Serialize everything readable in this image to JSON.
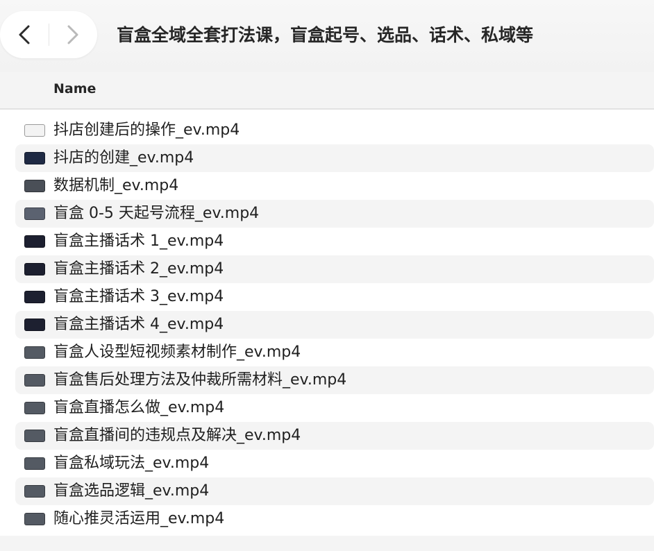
{
  "window": {
    "title": "盲盒全域全套打法课，盲盒起号、选品、话术、私域等",
    "back_icon": "chevron-left-icon",
    "forward_icon": "chevron-right-icon"
  },
  "columns": {
    "name": "Name"
  },
  "files": [
    {
      "name": "抖店创建后的操作_ev.mp4",
      "icon": "video-thumbnail-icon",
      "icon_color": "#f3f3f3"
    },
    {
      "name": "抖店的创建_ev.mp4",
      "icon": "video-thumbnail-icon",
      "icon_color": "#1f2a44"
    },
    {
      "name": "数据机制_ev.mp4",
      "icon": "video-thumbnail-icon",
      "icon_color": "#4a4f57"
    },
    {
      "name": "盲盒 0-5 天起号流程_ev.mp4",
      "icon": "video-thumbnail-icon",
      "icon_color": "#5b6270"
    },
    {
      "name": "盲盒主播话术 1_ev.mp4",
      "icon": "video-thumbnail-icon",
      "icon_color": "#1d2030"
    },
    {
      "name": "盲盒主播话术 2_ev.mp4",
      "icon": "video-thumbnail-icon",
      "icon_color": "#1d2030"
    },
    {
      "name": "盲盒主播话术 3_ev.mp4",
      "icon": "video-thumbnail-icon",
      "icon_color": "#1d2030"
    },
    {
      "name": "盲盒主播话术 4_ev.mp4",
      "icon": "video-thumbnail-icon",
      "icon_color": "#1d2030"
    },
    {
      "name": "盲盒人设型短视频素材制作_ev.mp4",
      "icon": "video-thumbnail-icon",
      "icon_color": "#545a63"
    },
    {
      "name": "盲盒售后处理方法及仲裁所需材料_ev.mp4",
      "icon": "video-thumbnail-icon",
      "icon_color": "#545a63"
    },
    {
      "name": "盲盒直播怎么做_ev.mp4",
      "icon": "video-thumbnail-icon",
      "icon_color": "#545a63"
    },
    {
      "name": "盲盒直播间的违规点及解决_ev.mp4",
      "icon": "video-thumbnail-icon",
      "icon_color": "#545a63"
    },
    {
      "name": "盲盒私域玩法_ev.mp4",
      "icon": "video-thumbnail-icon",
      "icon_color": "#545a63"
    },
    {
      "name": "盲盒选品逻辑_ev.mp4",
      "icon": "video-thumbnail-icon",
      "icon_color": "#545a63"
    },
    {
      "name": "随心推灵活运用_ev.mp4",
      "icon": "video-thumbnail-icon",
      "icon_color": "#545a63"
    }
  ]
}
